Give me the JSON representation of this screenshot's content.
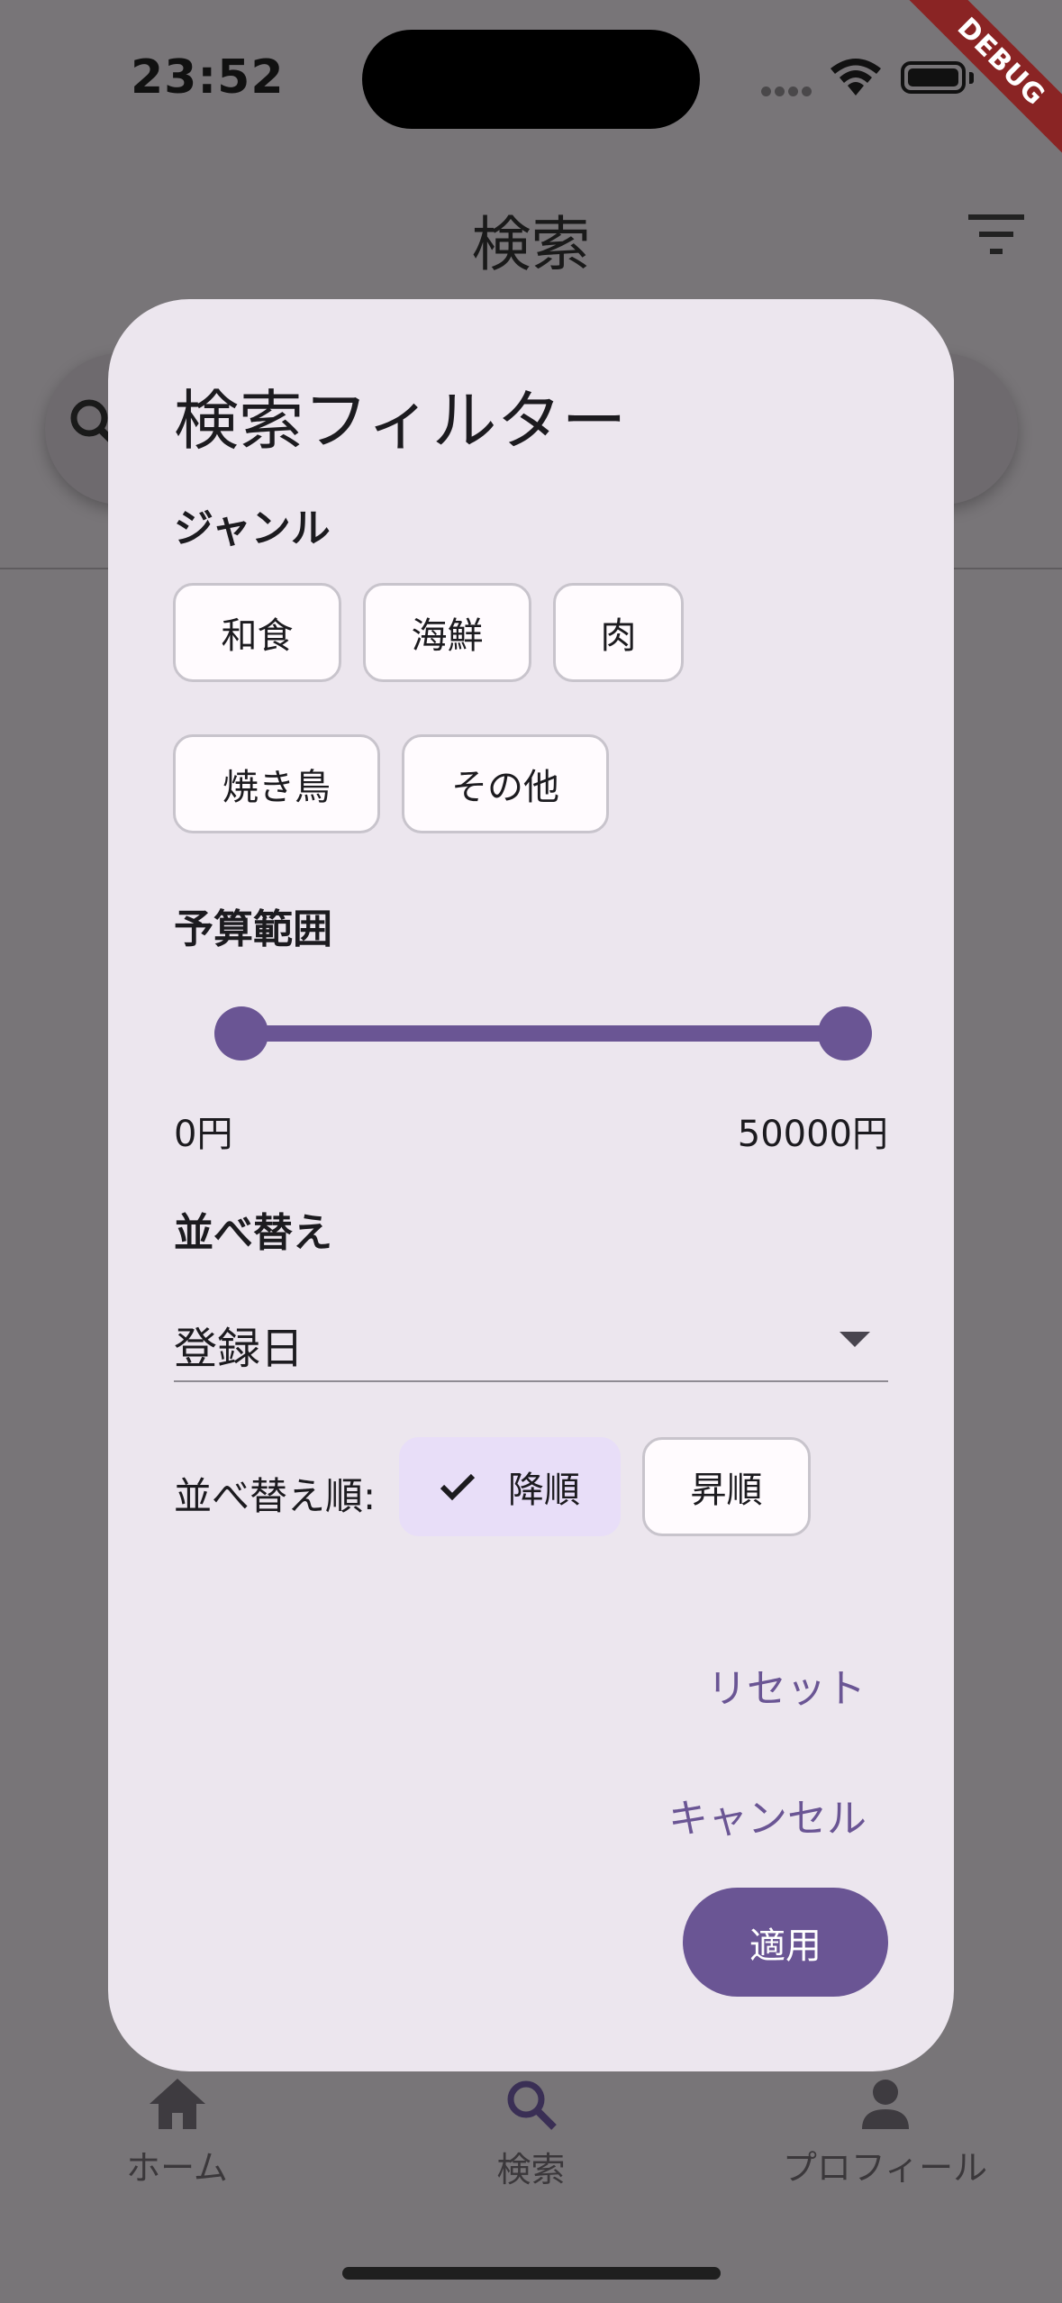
{
  "status_bar": {
    "time": "23:52",
    "debug_label": "DEBUG"
  },
  "app_bar": {
    "title": "検索"
  },
  "bottom_nav": {
    "items": [
      {
        "label": "ホーム",
        "icon": "home-icon"
      },
      {
        "label": "検索",
        "icon": "search-icon"
      },
      {
        "label": "プロフィール",
        "icon": "person-icon"
      }
    ]
  },
  "dialog": {
    "title": "検索フィルター",
    "genre": {
      "label": "ジャンル",
      "chips": [
        "和食",
        "海鮮",
        "肉",
        "焼き鳥",
        "その他"
      ]
    },
    "budget": {
      "label": "予算範囲",
      "min_label": "0円",
      "max_label": "50000円",
      "range_min": 0,
      "range_max": 50000,
      "selected_min": 0,
      "selected_max": 50000
    },
    "sort": {
      "label": "並べ替え",
      "selected": "登録日",
      "order_label": "並べ替え順:",
      "descending": "降順",
      "ascending": "昇順",
      "selected_order": "降順"
    },
    "actions": {
      "reset": "リセット",
      "cancel": "キャンセル",
      "apply": "適用"
    }
  },
  "colors": {
    "primary": "#6a5594",
    "dialog_bg": "#ece6ee",
    "scrim_bg": "#787578",
    "chip_selected": "#e8def8",
    "debug_banner": "#8a2424"
  }
}
